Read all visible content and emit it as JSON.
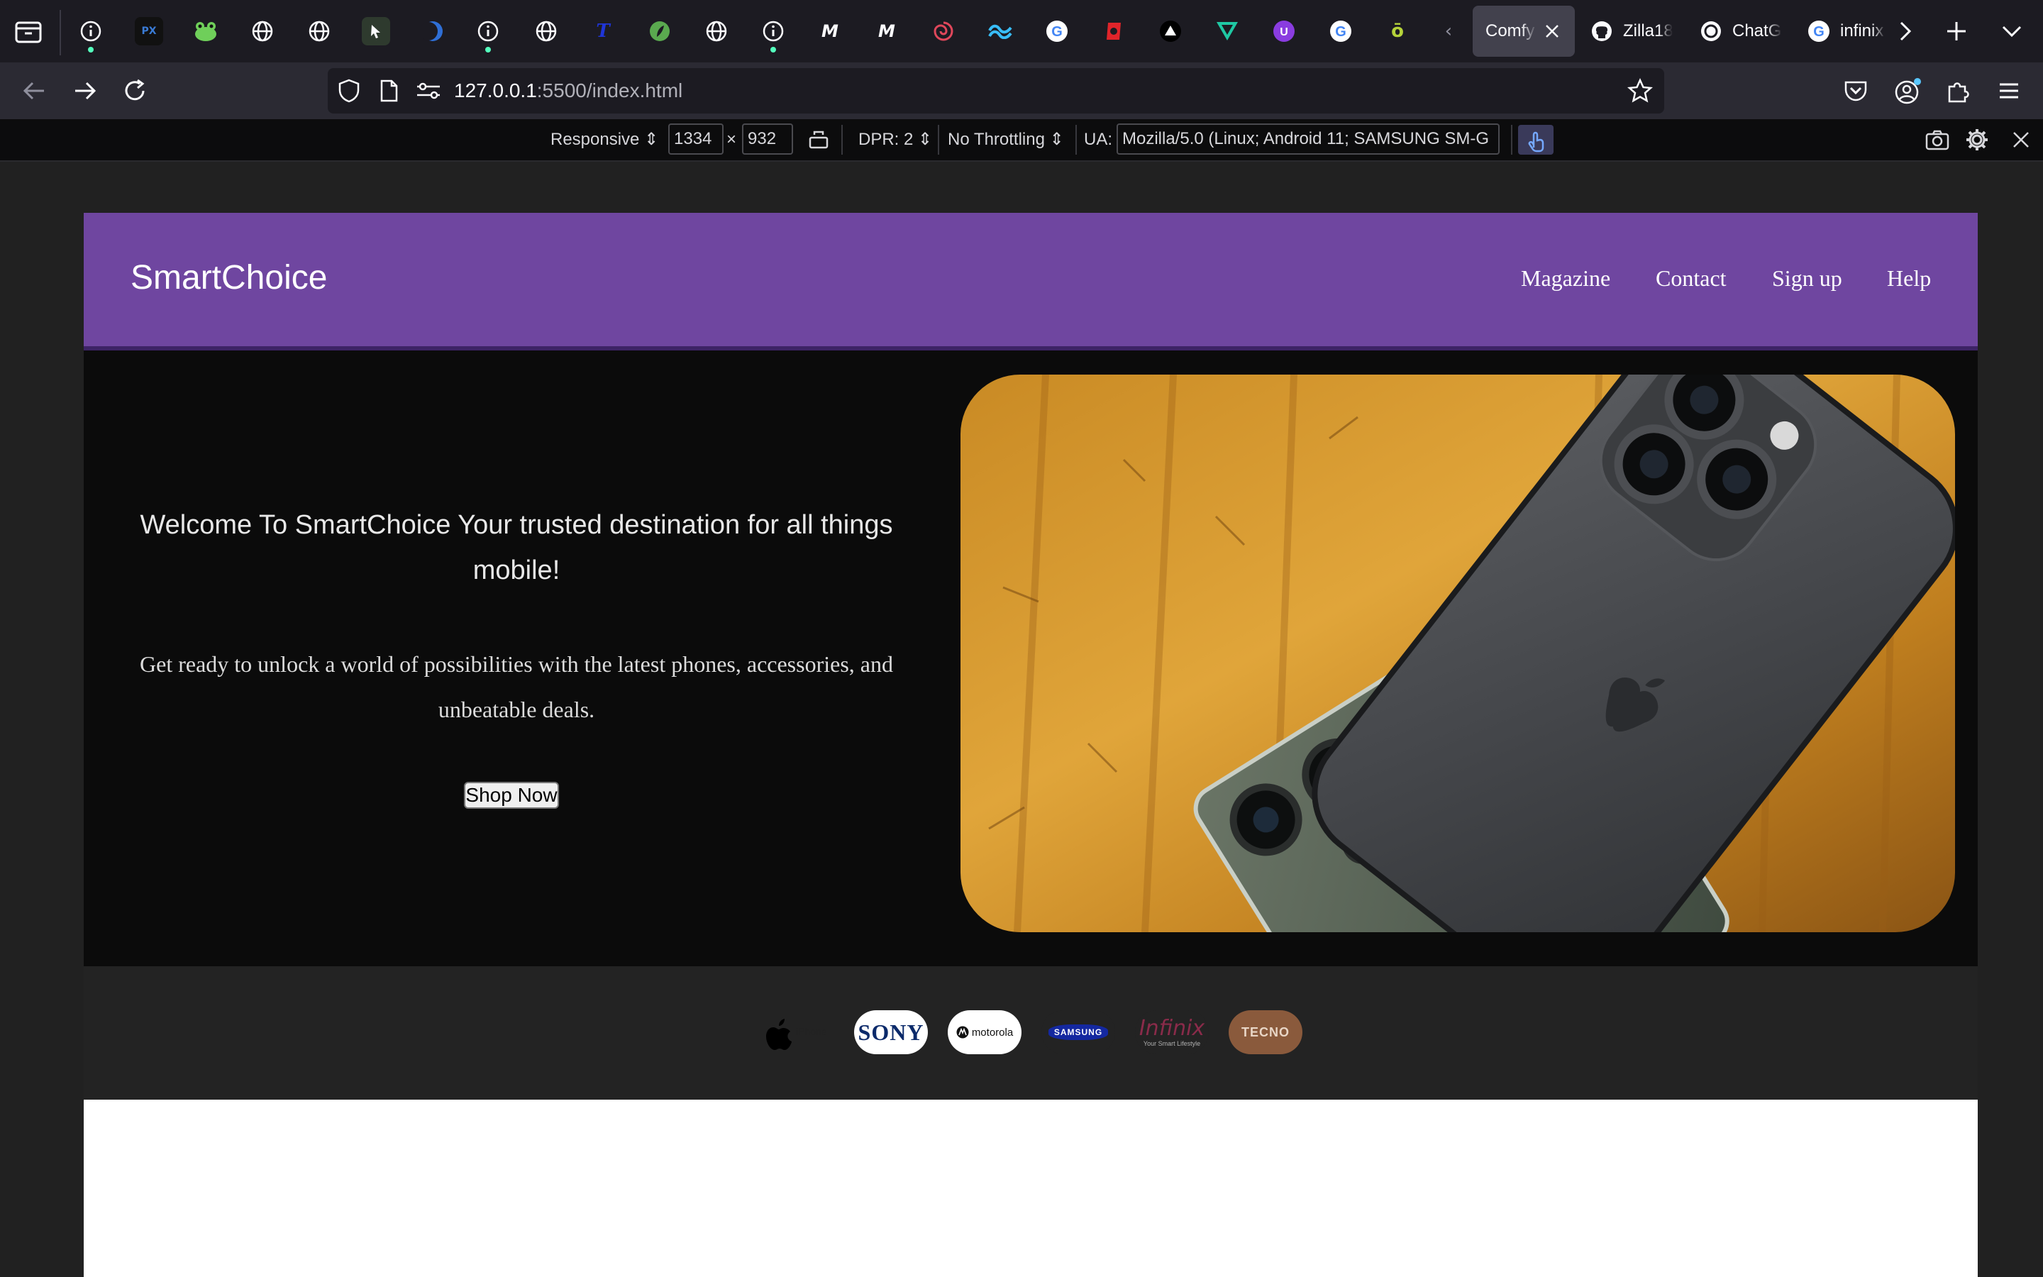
{
  "browser": {
    "active_tab": {
      "title": "Comfy ("
    },
    "tabs": [
      {
        "title": "Zilla18"
      },
      {
        "title": "ChatG"
      },
      {
        "title": "infinix"
      }
    ],
    "url": {
      "host": "127.0.0.1",
      "rest": ":5500/index.html"
    }
  },
  "devtools": {
    "mode": "Responsive",
    "width": "1334",
    "times": "×",
    "height": "932",
    "dpr": "DPR: 2",
    "throttling": "No Throttling",
    "ua_label": "UA:",
    "ua_value": "Mozilla/5.0 (Linux; Android 11; SAMSUNG SM-G"
  },
  "site": {
    "logo": "SmartChoice",
    "nav": [
      "Magazine",
      "Contact",
      "Sign up",
      "Help"
    ],
    "hero": {
      "title": "Welcome To SmartChoice Your trusted destination for all things mobile!",
      "subtitle": "Get ready to unlock a world of possibilities with the latest phones, accessories, and unbeatable deals.",
      "cta": "Shop Now"
    },
    "brands": [
      {
        "name": "iphone-logo",
        "text": "iPhone"
      },
      {
        "name": "sony-logo",
        "text": "SONY"
      },
      {
        "name": "motorola-logo",
        "text": "motorola"
      },
      {
        "name": "samsung-logo",
        "text": "SAMSUNG"
      },
      {
        "name": "infinix-logo",
        "text": "Infinix",
        "tagline": "Your Smart Lifestyle"
      },
      {
        "name": "tecno-logo",
        "text": "TECNO"
      }
    ]
  },
  "colors": {
    "header_purple": "#6f46a0",
    "hero_bg": "#0b0b0b",
    "brands_bg": "#232323",
    "browser_bg": "#1c1b22"
  }
}
